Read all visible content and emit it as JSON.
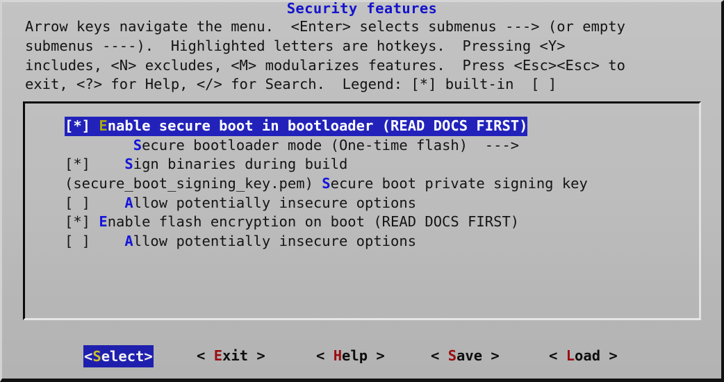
{
  "window": {
    "title": "Security features",
    "background_color": "#bdbdbd",
    "title_color": "#1414cc",
    "highlight_bg": "#2222bb",
    "hotkey_color": "#1515d8",
    "selected_hotkey_color": "#a9a910",
    "button_hotkey_color": "#9a0c10"
  },
  "help": {
    "line1": "Arrow keys navigate the menu.  <Enter> selects submenus ---> (or empty",
    "line2": "submenus ----).  Highlighted letters are hotkeys.  Pressing <Y>",
    "line3": "includes, <N> excludes, <M> modularizes features.  Press <Esc><Esc> to",
    "line4": "exit, <?> for Help, </> for Search.  Legend: [*] built-in  [ ]"
  },
  "menu": {
    "items": [
      {
        "selected": true,
        "prefix": "[*] ",
        "hotkey": "E",
        "label": "nable secure boot in bootloader (READ DOCS FIRST)",
        "state": "built-in",
        "type": "checkbox"
      },
      {
        "selected": false,
        "prefix": "        ",
        "hotkey": "S",
        "label": "ecure bootloader mode (One-time flash)  --->",
        "state": "submenu",
        "type": "submenu"
      },
      {
        "selected": false,
        "prefix": "[*]    ",
        "hotkey": "S",
        "label": "ign binaries during build",
        "state": "built-in",
        "type": "checkbox"
      },
      {
        "selected": false,
        "prefix": "(secure_boot_signing_key.pem) ",
        "hotkey": "S",
        "label": "ecure boot private signing key",
        "state": "secure_boot_signing_key.pem",
        "type": "string"
      },
      {
        "selected": false,
        "prefix": "[ ]    ",
        "hotkey": "A",
        "label": "llow potentially insecure options",
        "state": "excluded",
        "type": "checkbox"
      },
      {
        "selected": false,
        "prefix": "[*] ",
        "hotkey": "E",
        "label": "nable flash encryption on boot (READ DOCS FIRST)",
        "state": "built-in",
        "type": "checkbox"
      },
      {
        "selected": false,
        "prefix": "[ ]    ",
        "hotkey": "A",
        "label": "llow potentially insecure options",
        "state": "excluded",
        "type": "checkbox"
      }
    ]
  },
  "buttons": [
    {
      "id": "select",
      "left": "<",
      "pre": "",
      "hotkey": "S",
      "post": "elect",
      "right": ">",
      "selected": true,
      "text": "<Select>"
    },
    {
      "id": "exit",
      "left": "< ",
      "pre": "",
      "hotkey": "E",
      "post": "xit",
      "right": " >",
      "selected": false,
      "text": "< Exit >"
    },
    {
      "id": "help",
      "left": "< ",
      "pre": "",
      "hotkey": "H",
      "post": "elp",
      "right": " >",
      "selected": false,
      "text": "< Help >"
    },
    {
      "id": "save",
      "left": "< ",
      "pre": "",
      "hotkey": "S",
      "post": "ave",
      "right": " >",
      "selected": false,
      "text": "< Save >"
    },
    {
      "id": "load",
      "left": "< ",
      "pre": "",
      "hotkey": "L",
      "post": "oad",
      "right": " >",
      "selected": false,
      "text": "< Load >"
    }
  ]
}
